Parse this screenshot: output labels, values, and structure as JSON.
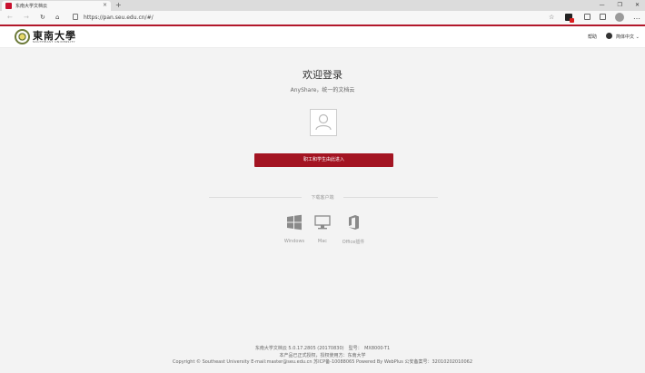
{
  "browser": {
    "tab_title": "东南大学文档云",
    "tab_close": "×",
    "new_tab": "+",
    "window_controls": [
      "—",
      "❐",
      "✕"
    ],
    "url": "https://pan.seu.edu.cn/#/",
    "nav": [
      "←",
      "→",
      "↻",
      "⌂"
    ],
    "star": "☆",
    "menu": "…"
  },
  "header": {
    "logo_text": "東南大學",
    "logo_subtext": "SOUTHEAST UNIVERSITY",
    "help": "帮助",
    "language": "简体中文 ⌄"
  },
  "login": {
    "title": "欢迎登录",
    "subtitle": "AnyShare，统一的文档云",
    "button": "职工和学生由此进入"
  },
  "clients": {
    "section_label": "下载客户端",
    "items": [
      {
        "label": "Windows",
        "icon": "windows-icon"
      },
      {
        "label": "Mac",
        "icon": "monitor-icon"
      },
      {
        "label": "Office插件",
        "icon": "office-icon"
      }
    ]
  },
  "footer": {
    "line1": "东南大学文档云 5.0.17.2805 (20170830)　型号：　MX8000-T1",
    "line2": "本产品已正式授权，授权使用方：东南大学",
    "line3": "Copyright © Southeast University E-mail:master@seu.edu.cn 苏ICP备-10088065 Powered By WebPlus 公安备案号：32010202010062"
  },
  "colors": {
    "brand_red": "#a31422",
    "chrome_bg": "#f7f7f7",
    "page_bg": "#f3f3f3"
  }
}
